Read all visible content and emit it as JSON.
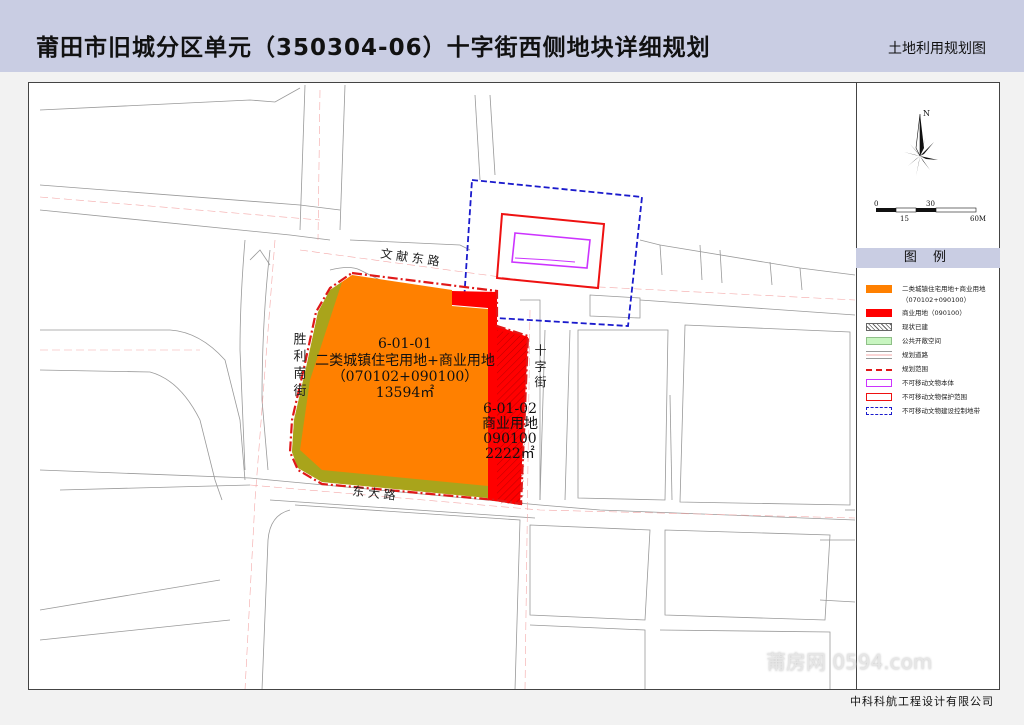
{
  "header": {
    "title": "莆田市旧城分区单元（350304-06）十字街西侧地块详细规划",
    "subtitle": "土地利用规划图"
  },
  "map": {
    "streets": {
      "wenxian": "文 献 东 路",
      "shengli": "胜 利 南 街",
      "dongda": "东 大 路",
      "shizi": "十 字 街"
    },
    "parcels": [
      {
        "code": "6-01-01",
        "use": "二类城镇住宅用地+商业用地",
        "use_code": "（070102+090100）",
        "area": "13594㎡",
        "color": "#ff8000"
      },
      {
        "code": "6-01-02",
        "use": "商业用地",
        "use_code": "090100",
        "area": "2222㎡",
        "color": "#ff0000"
      }
    ]
  },
  "compass": {
    "north": "N",
    "scale_labels": [
      "0",
      "15",
      "30",
      "60M"
    ]
  },
  "legend": {
    "title": "图 例",
    "items": [
      {
        "label": "二类城镇住宅用地+商业用地",
        "label2": "（070102+090100）",
        "swatch": "orange"
      },
      {
        "label": "商业用地（090100）",
        "swatch": "red"
      },
      {
        "label": "现状已建",
        "swatch": "hatch"
      },
      {
        "label": "公共开敞空间",
        "swatch": "green"
      },
      {
        "label": "规划道路",
        "swatch": "road"
      },
      {
        "label": "规划范围",
        "swatch": "boundary"
      },
      {
        "label": "不可移动文物本体",
        "swatch": "magenta"
      },
      {
        "label": "不可移动文物保护范围",
        "swatch": "redline"
      },
      {
        "label": "不可移动文物建设控制地带",
        "swatch": "bluedash"
      }
    ],
    "colors": {
      "orange": "#ff8000",
      "red": "#ff0000",
      "green": "#c8f5c0",
      "magenta": "#cc33ff",
      "blue": "#0000cc"
    }
  },
  "footer": {
    "company": "中科科航工程设计有限公司"
  },
  "watermark": {
    "text": "莆房网 0594.com"
  }
}
